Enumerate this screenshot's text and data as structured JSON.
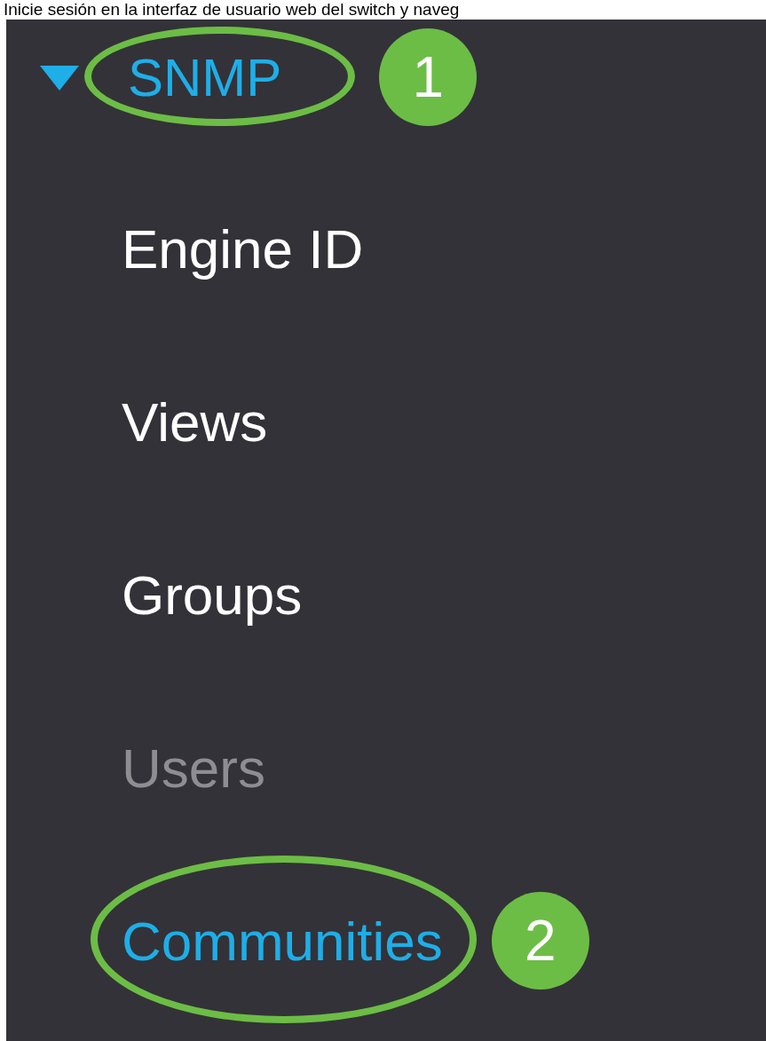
{
  "caption": "Inicie sesión en la interfaz de usuario web del switch y naveg",
  "menu": {
    "label": "SNMP",
    "expanded": true,
    "callout": "1",
    "children": [
      {
        "label": "Engine ID",
        "selected": false,
        "disabled": false
      },
      {
        "label": "Views",
        "selected": false,
        "disabled": false
      },
      {
        "label": "Groups",
        "selected": false,
        "disabled": false
      },
      {
        "label": "Users",
        "selected": false,
        "disabled": true
      },
      {
        "label": "Communities",
        "selected": true,
        "disabled": false,
        "callout": "2"
      }
    ]
  }
}
